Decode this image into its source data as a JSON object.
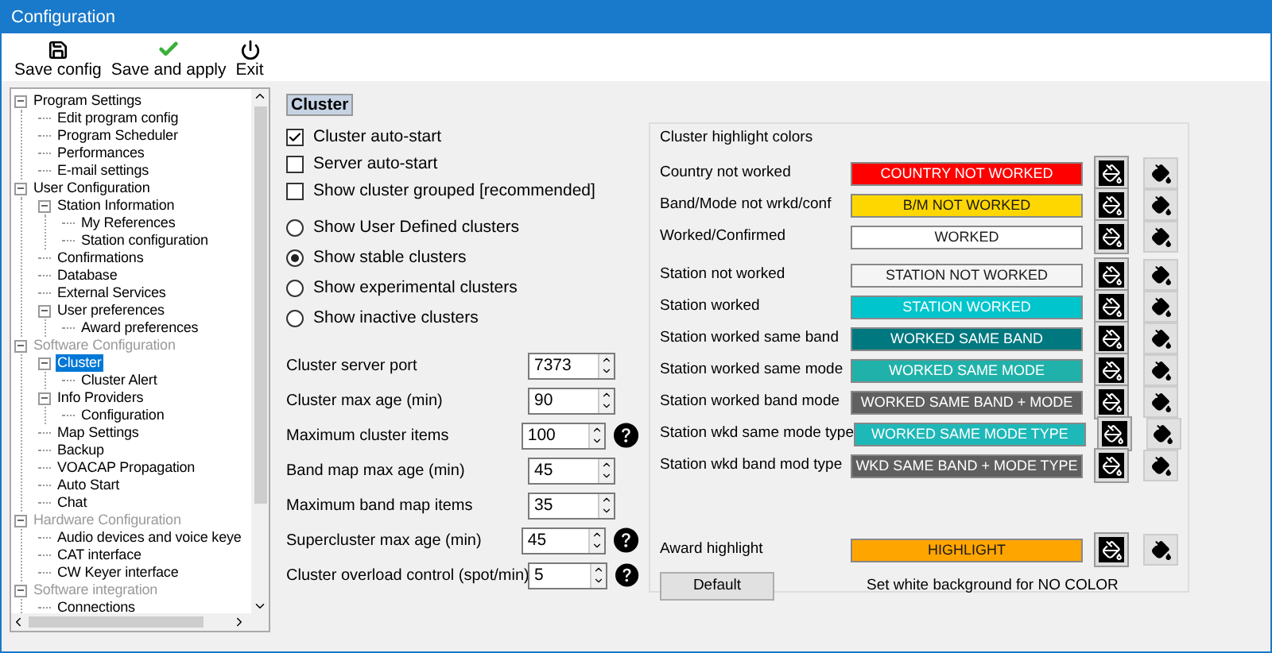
{
  "window": {
    "title": "Configuration"
  },
  "toolbar": [
    {
      "kind": "save",
      "label": "Save config"
    },
    {
      "kind": "apply",
      "label": "Save and apply"
    },
    {
      "kind": "exit",
      "label": "Exit"
    }
  ],
  "tree": [
    {
      "label": "Program Settings",
      "dimmed": false,
      "selected": false,
      "expanded": true,
      "children": [
        {
          "label": "Edit program config",
          "dimmed": false,
          "selected": false
        },
        {
          "label": "Program Scheduler",
          "dimmed": false,
          "selected": false
        },
        {
          "label": "Performances",
          "dimmed": false,
          "selected": false
        },
        {
          "label": "E-mail settings",
          "dimmed": false,
          "selected": false
        }
      ]
    },
    {
      "label": "User Configuration",
      "dimmed": false,
      "selected": false,
      "expanded": true,
      "children": [
        {
          "label": "Station Information",
          "dimmed": false,
          "selected": false,
          "expanded": true,
          "children": [
            {
              "label": "My References",
              "dimmed": false,
              "selected": false
            },
            {
              "label": "Station configuration",
              "dimmed": false,
              "selected": false
            }
          ]
        },
        {
          "label": "Confirmations",
          "dimmed": false,
          "selected": false
        },
        {
          "label": "Database",
          "dimmed": false,
          "selected": false
        },
        {
          "label": "External Services",
          "dimmed": false,
          "selected": false
        },
        {
          "label": "User preferences",
          "dimmed": false,
          "selected": false,
          "expanded": true,
          "children": [
            {
              "label": "Award preferences",
              "dimmed": false,
              "selected": false
            }
          ]
        }
      ]
    },
    {
      "label": "Software Configuration",
      "dimmed": true,
      "selected": false,
      "expanded": true,
      "children": [
        {
          "label": "Cluster",
          "dimmed": false,
          "selected": true,
          "expanded": true,
          "children": [
            {
              "label": "Cluster Alert",
              "dimmed": false,
              "selected": false
            }
          ]
        },
        {
          "label": "Info Providers",
          "dimmed": false,
          "selected": false,
          "expanded": true,
          "children": [
            {
              "label": "Configuration",
              "dimmed": false,
              "selected": false
            }
          ]
        },
        {
          "label": "Map Settings",
          "dimmed": false,
          "selected": false
        },
        {
          "label": "Backup",
          "dimmed": false,
          "selected": false
        },
        {
          "label": "VOACAP Propagation",
          "dimmed": false,
          "selected": false
        },
        {
          "label": "Auto Start",
          "dimmed": false,
          "selected": false
        },
        {
          "label": "Chat",
          "dimmed": false,
          "selected": false
        }
      ]
    },
    {
      "label": "Hardware Configuration",
      "dimmed": true,
      "selected": false,
      "expanded": true,
      "children": [
        {
          "label": "Audio devices and voice keye",
          "dimmed": false,
          "selected": false
        },
        {
          "label": "CAT interface",
          "dimmed": false,
          "selected": false
        },
        {
          "label": "CW Keyer interface",
          "dimmed": false,
          "selected": false
        }
      ]
    },
    {
      "label": "Software integration",
      "dimmed": true,
      "selected": false,
      "expanded": true,
      "children": [
        {
          "label": "Connections",
          "dimmed": false,
          "selected": false
        }
      ]
    }
  ],
  "section_title": "Cluster",
  "checkboxes": [
    {
      "label": "Cluster auto-start",
      "checked": true
    },
    {
      "label": "Server auto-start",
      "checked": false
    },
    {
      "label": "Show cluster grouped [recommended]",
      "checked": false
    }
  ],
  "radios": [
    {
      "label": "Show User Defined clusters",
      "selected": false
    },
    {
      "label": "Show stable clusters",
      "selected": true
    },
    {
      "label": "Show experimental clusters",
      "selected": false
    },
    {
      "label": "Show inactive clusters",
      "selected": false
    }
  ],
  "spinners": [
    {
      "label": "Cluster server port",
      "value": "7373",
      "help": false
    },
    {
      "label": "Cluster max age (min)",
      "value": "90",
      "help": false
    },
    {
      "label": "Maximum cluster items",
      "value": "100",
      "help": true
    },
    {
      "label": "Band map max age (min)",
      "value": "45",
      "help": false
    },
    {
      "label": "Maximum band map items",
      "value": "35",
      "help": false
    },
    {
      "label": "Supercluster max age (min)",
      "value": "45",
      "help": true
    },
    {
      "label": "Cluster overload control (spot/min)",
      "value": "5",
      "help": true
    }
  ],
  "highlight_colors": {
    "title": "Cluster highlight colors",
    "rows": [
      {
        "label": "Country not worked",
        "sample": "COUNTRY NOT WORKED",
        "color": "#ff0000"
      },
      {
        "label": "Band/Mode not wrkd/conf",
        "sample": "B/M NOT WORKED",
        "color": "#ffd700"
      },
      {
        "label": "Worked/Confirmed",
        "sample": "WORKED",
        "color": "#ffffff"
      },
      {
        "label": "Station not worked",
        "sample": "STATION NOT WORKED",
        "color": "#f5f5f5"
      },
      {
        "label": "Station worked",
        "sample": "STATION WORKED",
        "color": "#00c5cd"
      },
      {
        "label": "Station worked same band",
        "sample": "WORKED SAME BAND",
        "color": "#00787f"
      },
      {
        "label": "Station worked same mode",
        "sample": "WORKED SAME MODE",
        "color": "#20b2aa"
      },
      {
        "label": "Station worked band mode",
        "sample": "WORKED SAME BAND + MODE",
        "color": "#606060"
      },
      {
        "label": "Station wkd same mode type",
        "sample": "WORKED SAME MODE TYPE",
        "color": "#1fb8b8"
      },
      {
        "label": "Station wkd band mod type",
        "sample": "WKD SAME BAND + MODE TYPE",
        "color": "#5f5f5f"
      }
    ],
    "award": {
      "label": "Award highlight",
      "sample": "HIGHLIGHT",
      "color": "#ffa500"
    },
    "default_button": "Default",
    "note": "Set white background for NO COLOR"
  }
}
